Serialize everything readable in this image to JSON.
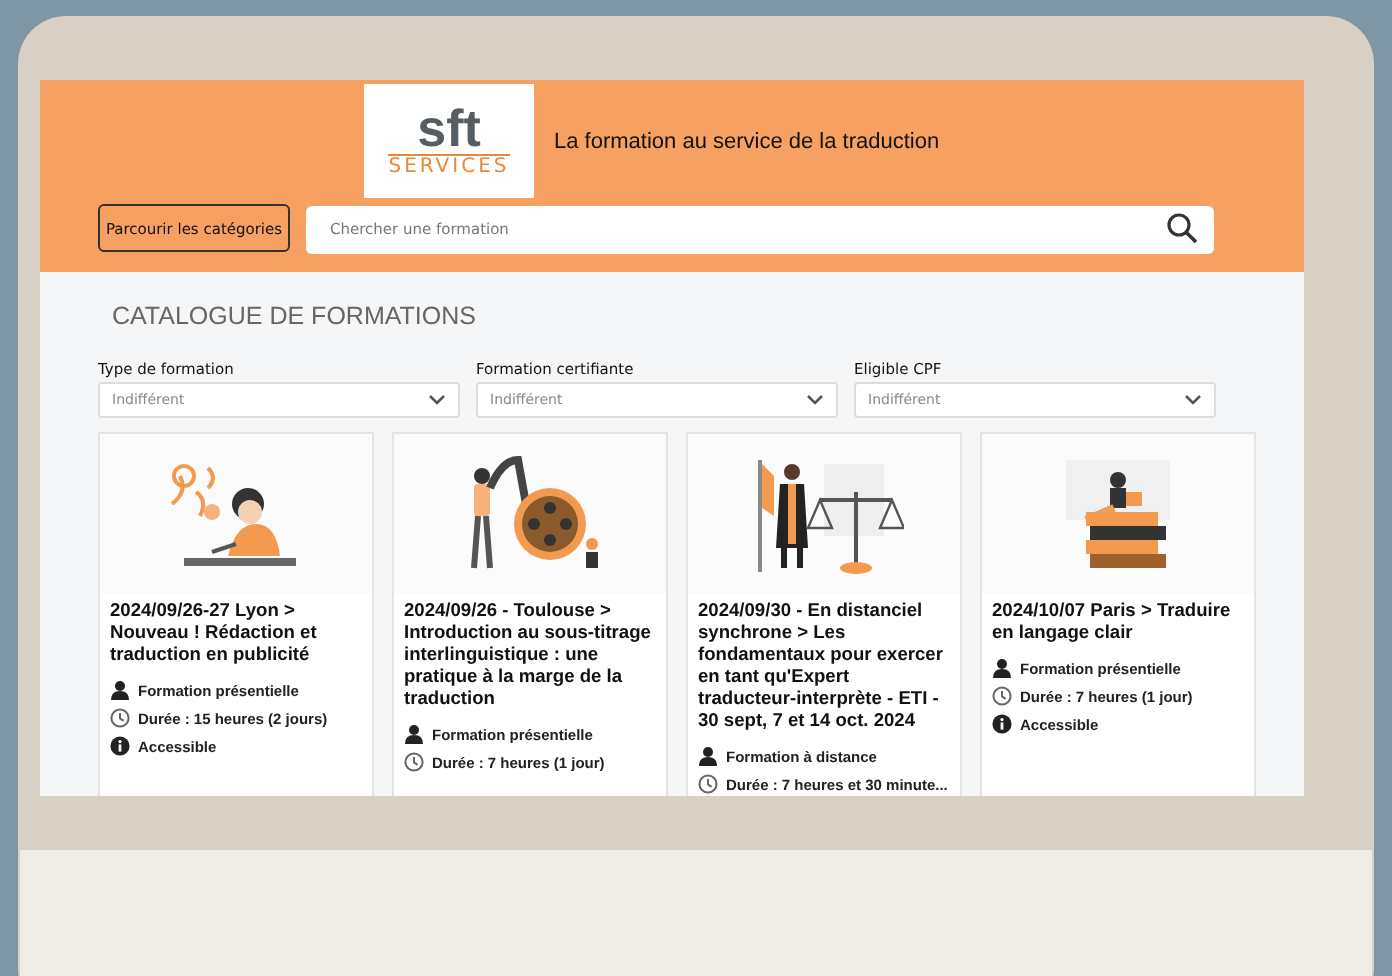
{
  "header": {
    "logo": {
      "top": "sft",
      "bottom": "SERVICES"
    },
    "tagline": "La formation au service de la traduction",
    "categories_button": "Parcourir les catégories",
    "search": {
      "placeholder": "Chercher une formation"
    }
  },
  "page_title": "CATALOGUE DE FORMATIONS",
  "filters": [
    {
      "label": "Type de formation",
      "value": "Indifférent"
    },
    {
      "label": "Formation certifiante",
      "value": "Indifférent"
    },
    {
      "label": "Eligible CPF",
      "value": "Indifférent"
    }
  ],
  "courses": [
    {
      "kind": "writing",
      "title": "2024/09/26-27 Lyon > Nouveau ! Rédaction et traduction en publicité",
      "details": [
        {
          "kind": "mode",
          "text": "Formation présentielle"
        },
        {
          "kind": "duration",
          "text": "Durée : 15 heures (2 jours)"
        },
        {
          "kind": "accessibility",
          "text": "Accessible"
        }
      ]
    },
    {
      "kind": "film",
      "title": "2024/09/26 - Toulouse > Introduction au sous-titrage interlinguistique : une pratique à la marge de la traduction",
      "details": [
        {
          "kind": "mode",
          "text": "Formation présentielle"
        },
        {
          "kind": "duration",
          "text": "Durée : 7 heures (1 jour)"
        }
      ]
    },
    {
      "kind": "law",
      "title": "2024/09/30 - En distanciel synchrone > Les fondamentaux pour exercer en tant qu'Expert traducteur-interprète - ETI - 30 sept, 7 et 14 oct. 2024",
      "details": [
        {
          "kind": "mode",
          "text": "Formation à distance"
        },
        {
          "kind": "duration",
          "text": "Durée : 7 heures et 30 minute..."
        }
      ]
    },
    {
      "kind": "books",
      "title": "2024/10/07 Paris > Traduire en langage clair",
      "details": [
        {
          "kind": "mode",
          "text": "Formation présentielle"
        },
        {
          "kind": "duration",
          "text": "Durée : 7 heures (1 jour)"
        },
        {
          "kind": "accessibility",
          "text": "Accessible"
        }
      ]
    }
  ]
}
